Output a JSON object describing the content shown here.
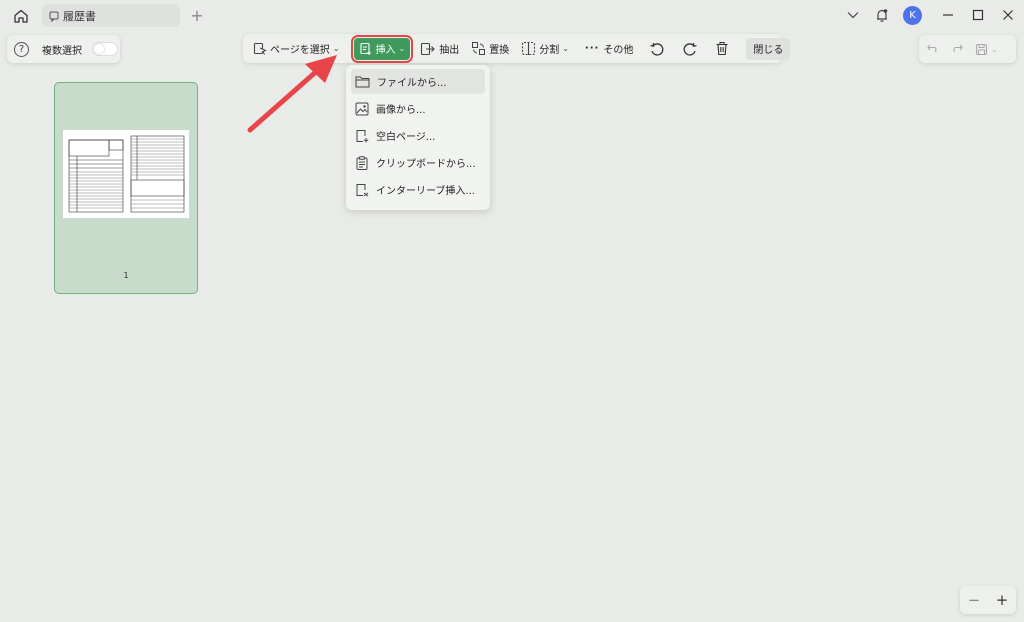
{
  "titlebar": {
    "tab_title": "履歴書",
    "avatar_letter": "K"
  },
  "left_panel": {
    "multi_select_label": "複数選択",
    "multi_select_on": false
  },
  "toolbar": {
    "select_page": "ページを選択",
    "insert": "挿入",
    "extract": "抽出",
    "replace": "置換",
    "split": "分割",
    "more": "その他",
    "close": "閉じる"
  },
  "insert_menu": {
    "items": [
      {
        "label": "ファイルから...",
        "icon": "folder-icon"
      },
      {
        "label": "画像から...",
        "icon": "image-icon"
      },
      {
        "label": "空白ページ...",
        "icon": "blank-page-icon"
      },
      {
        "label": "クリップボードから...",
        "icon": "clipboard-icon"
      },
      {
        "label": "インターリーブ挿入...",
        "icon": "interleave-icon"
      }
    ]
  },
  "pages": [
    {
      "number": "1"
    }
  ],
  "colors": {
    "accent_green": "#3f9a5c",
    "highlight_red": "#e04848",
    "thumbnail_selected": "#c8dccc"
  }
}
